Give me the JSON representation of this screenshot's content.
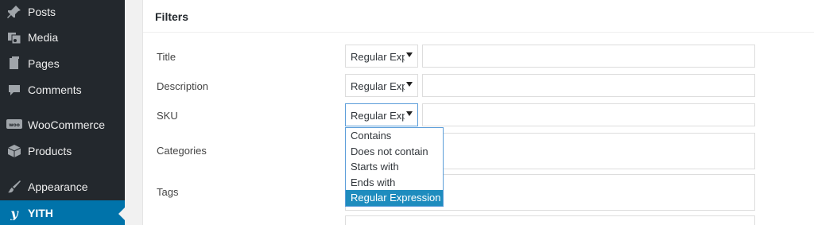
{
  "sidebar": {
    "items": [
      {
        "label": "Posts",
        "icon": "pin-icon"
      },
      {
        "label": "Media",
        "icon": "media-icon"
      },
      {
        "label": "Pages",
        "icon": "pages-icon"
      },
      {
        "label": "Comments",
        "icon": "comment-icon"
      },
      {
        "label": "WooCommerce",
        "icon": "woocommerce-icon"
      },
      {
        "label": "Products",
        "icon": "products-icon"
      },
      {
        "label": "Appearance",
        "icon": "brush-icon"
      },
      {
        "label": "YITH",
        "icon": "yith-icon"
      }
    ],
    "active_index": 7
  },
  "panel": {
    "title": "Filters",
    "rows": [
      {
        "label": "Title",
        "select_value": "Regular Expression"
      },
      {
        "label": "Description",
        "select_value": "Regular Expression"
      },
      {
        "label": "SKU",
        "select_value": "Regular Expression"
      },
      {
        "label": "Categories"
      },
      {
        "label": "Tags"
      }
    ]
  },
  "dropdown": {
    "options": [
      "Contains",
      "Does not contain",
      "Starts with",
      "Ends with",
      "Regular Expression"
    ],
    "selected_index": 4
  },
  "colors": {
    "sidebar_bg": "#23282d",
    "active_bg": "#0073aa",
    "focus_border": "#5b9dd9",
    "highlight": "#1e8cbe"
  }
}
